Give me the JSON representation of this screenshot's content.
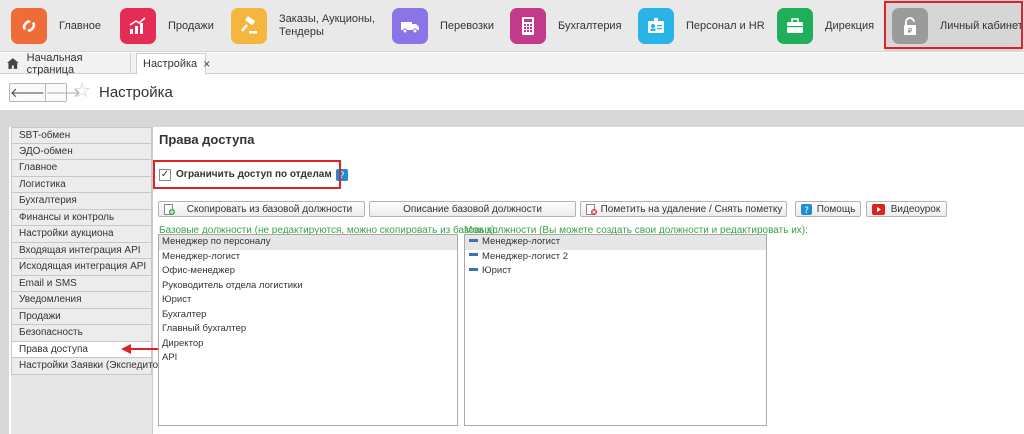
{
  "modules": [
    {
      "label": "Главное",
      "icon": "logo-icon",
      "color": "#ef6b3a"
    },
    {
      "label": "Продажи",
      "icon": "sales-chart-icon",
      "color": "#e52c57"
    },
    {
      "label": "Заказы, Аукционы, Тендеры",
      "icon": "gavel-icon",
      "color": "#f4b63d"
    },
    {
      "label": "Перевозки",
      "icon": "truck-icon",
      "color": "#8a74e6"
    },
    {
      "label": "Бухгалтерия",
      "icon": "calculator-icon",
      "color": "#c23b8a"
    },
    {
      "label": "Персонал и HR",
      "icon": "badge-icon",
      "color": "#29b3e6"
    },
    {
      "label": "Дирекция",
      "icon": "briefcase-icon",
      "color": "#1fae5a"
    },
    {
      "label": "Личный кабинет",
      "icon": "lock-icon",
      "color": "#9b9b9b"
    }
  ],
  "tabs": {
    "home": "Начальная страница",
    "current": "Настройка",
    "close": "×"
  },
  "header": {
    "title": "Настройка",
    "back": "🡐",
    "forward": "🡒",
    "star": "☆"
  },
  "sidebar": {
    "items": [
      "SBT-обмен",
      "ЭДО-обмен",
      "Главное",
      "Логистика",
      "Бухгалтерия",
      "Финансы и контроль",
      "Настройки аукциона",
      "Входящая интеграция API",
      "Исходящая интеграция API",
      "Email и SMS",
      "Уведомления",
      "Продажи",
      "Безопасность",
      "Права доступа",
      "Настройки Заявки (Экспедитора)"
    ],
    "selected_index": 13
  },
  "main": {
    "title": "Права доступа",
    "restrict_checkbox": {
      "label": "Ограничить доступ по отделам",
      "checked": true,
      "mark": "✓"
    },
    "info_icon_glyph": "?",
    "buttons": {
      "copy": "Скопировать из базовой должности",
      "describe": "Описание базовой должности",
      "mark_delete": "Пометить на удаление / Снять пометку",
      "help": "Помощь",
      "video": "Видеоурок"
    },
    "base_hint": "Базовые должности (не редактируются, можно скопировать из базовых):",
    "my_hint": "Мои должности (Вы можете создать свои должности и редактировать их):",
    "base_positions": [
      "Менеджер по персоналу",
      "Менеджер-логист",
      "Офис-менеджер",
      "Руководитель отдела логистики",
      "Юрист",
      "Бухгалтер",
      "Главный бухгалтер",
      "Директор",
      "API"
    ],
    "my_positions": [
      "Менеджер-логист",
      "Менеджер-логист 2",
      "Юрист"
    ]
  },
  "colors": {
    "highlight_frame": "#e0202a",
    "hint_text": "#3aa14a",
    "accent": "#1d8ed6"
  }
}
